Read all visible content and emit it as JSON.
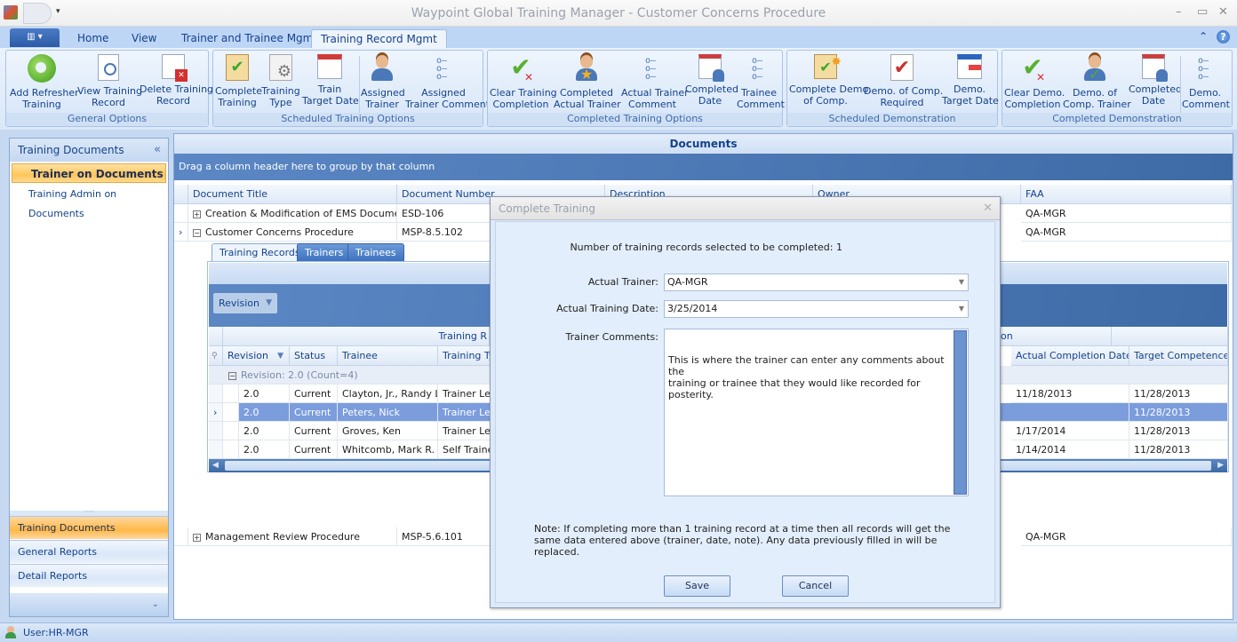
{
  "window": {
    "title": "Waypoint Global Training Manager - Customer Concerns Procedure",
    "minimize_icon": "minimize-icon",
    "maximize_icon": "maximize-icon",
    "close_icon": "close-icon"
  },
  "ribbon": {
    "app_menu_icon": "app-menu-icon",
    "tabs": [
      {
        "label": "Home"
      },
      {
        "label": "View"
      },
      {
        "label": "Trainer and Trainee Mgmt"
      },
      {
        "label": "Training Record Mgmt",
        "active": true
      }
    ],
    "groups": [
      {
        "caption": "General Options",
        "buttons": [
          {
            "label1": "Add Refresher",
            "label2": "Training",
            "icon": "refresh-icon"
          },
          {
            "label1": "View Training",
            "label2": "Record",
            "icon": "view-record-icon"
          },
          {
            "label1": "Delete Training",
            "label2": "Record",
            "icon": "delete-record-icon"
          }
        ]
      },
      {
        "caption": "Scheduled Training Options",
        "buttons": [
          {
            "label1": "Complete",
            "label2": "Training",
            "icon": "clipboard-check-icon"
          },
          {
            "label1": "Training",
            "label2": "Type",
            "icon": "settings-doc-icon"
          },
          {
            "label1": "Train",
            "label2": "Target Date",
            "icon": "calendar-icon"
          },
          {
            "label1": "Assigned",
            "label2": "Trainer",
            "icon": "person-icon"
          },
          {
            "label1": "Assigned",
            "label2": "Trainer Comment",
            "icon": "list-icon"
          }
        ]
      },
      {
        "caption": "Completed Training Options",
        "buttons": [
          {
            "label1": "Clear Training",
            "label2": "Completion",
            "icon": "clear-check-icon"
          },
          {
            "label1": "Completed",
            "label2": "Actual Trainer",
            "icon": "person-star-icon"
          },
          {
            "label1": "Actual Trainer",
            "label2": "Comment",
            "icon": "list-icon"
          },
          {
            "label1": "Completed",
            "label2": "Date",
            "icon": "calendar-person-icon"
          },
          {
            "label1": "Trainee",
            "label2": "Comment",
            "icon": "list-icon"
          }
        ]
      },
      {
        "caption": "Scheduled Demonstration",
        "buttons": [
          {
            "label1": "Complete Demo.",
            "label2": "of Comp.",
            "icon": "clipboard-star-icon"
          },
          {
            "label1": "Demo. of Comp.",
            "label2": "Required",
            "icon": "clipboard-required-icon"
          },
          {
            "label1": "Demo.",
            "label2": "Target Date",
            "icon": "calendar-icon"
          }
        ]
      },
      {
        "caption": "Completed Demonstration",
        "buttons": [
          {
            "label1": "Clear Demo.",
            "label2": "Completion",
            "icon": "clear-check-icon"
          },
          {
            "label1": "Demo. of",
            "label2": "Comp. Trainer",
            "icon": "person-check-icon"
          },
          {
            "label1": "Completed",
            "label2": "Date",
            "icon": "calendar-person-icon"
          },
          {
            "label1": "Demo.",
            "label2": "Comment",
            "icon": "list-icon"
          }
        ]
      }
    ]
  },
  "sidebar": {
    "header": "Training Documents",
    "items": [
      {
        "label": "Trainer on Documents",
        "selected": true
      },
      {
        "label": "Training Admin on Documents"
      }
    ],
    "nav": [
      {
        "label": "Training Documents",
        "selected": true
      },
      {
        "label": "General Reports"
      },
      {
        "label": "Detail Reports"
      }
    ]
  },
  "main": {
    "title": "Documents",
    "group_by_hint": "Drag a column header here to group by that column",
    "columns": [
      "Document Title",
      "Document Number",
      "Description",
      "Owner",
      "FAA"
    ],
    "rows": [
      {
        "title": "Creation & Modification of EMS Documents",
        "number": "ESD-106",
        "faa": "QA-MGR",
        "expanded": false
      },
      {
        "title": "Customer Concerns Procedure",
        "number": "MSP-8.5.102",
        "faa": "QA-MGR",
        "expanded": true
      },
      {
        "title": "Management Review Procedure",
        "number": "MSP-5.6.101",
        "faa": "QA-MGR",
        "expanded": false
      }
    ],
    "detail": {
      "tabs": [
        "Training Records",
        "Trainers",
        "Trainees"
      ],
      "group_chip": "Revision",
      "band_left": "Training R",
      "band_right": "on",
      "columns": [
        "Revision",
        "Status",
        "Trainee",
        "Training Ty",
        "Actual Completion Date",
        "Target Competence D"
      ],
      "group_row": "Revision: 2.0 (Count=4)",
      "rows": [
        {
          "revision": "2.0",
          "status": "Current",
          "trainee": "Clayton, Jr., Randy L.",
          "type": "Trainer Led",
          "actual": "11/18/2013",
          "target": "11/28/2013"
        },
        {
          "revision": "2.0",
          "status": "Current",
          "trainee": "Peters, Nick",
          "type": "Trainer Led",
          "actual": "",
          "target": "11/28/2013",
          "selected": true
        },
        {
          "revision": "2.0",
          "status": "Current",
          "trainee": "Groves, Ken",
          "type": "Trainer Led",
          "actual": "1/17/2014",
          "target": "11/28/2013"
        },
        {
          "revision": "2.0",
          "status": "Current",
          "trainee": "Whitcomb, Mark R.",
          "type": "Self Trained",
          "actual": "1/14/2014",
          "target": "11/28/2013"
        }
      ]
    }
  },
  "dialog": {
    "title": "Complete Training",
    "count_label": "Number of training records selected to be completed:  1",
    "trainer_label": "Actual Trainer:",
    "trainer_value": "QA-MGR",
    "date_label": "Actual Training Date:",
    "date_value": "3/25/2014",
    "comments_label": "Trainer Comments:",
    "comments_value": "This is where the trainer can enter any comments about the\ntraining or trainee that they would like recorded for posterity.",
    "note": "Note: If completing more than 1 training record at a time then all records will get the same data entered above (trainer, date, note).  Any data previously filled in will be replaced.",
    "save_label": "Save",
    "cancel_label": "Cancel"
  },
  "status": {
    "user": "User:HR-MGR"
  }
}
